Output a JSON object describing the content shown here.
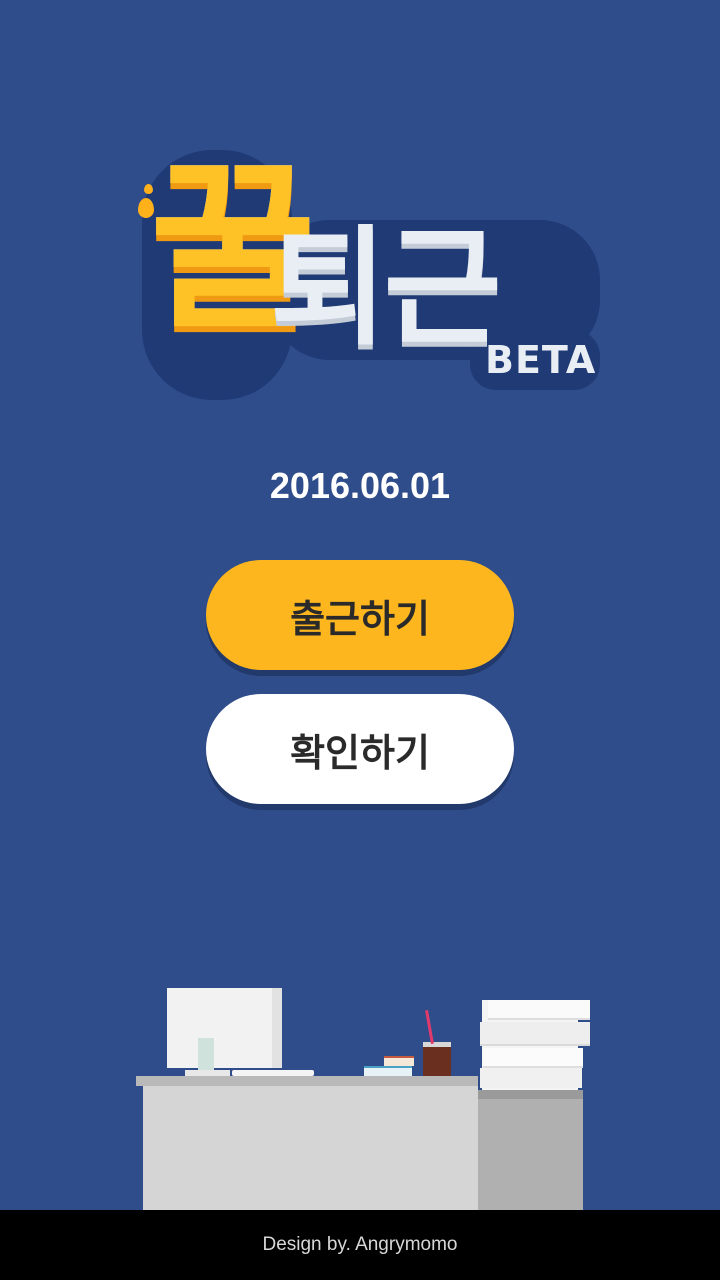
{
  "app": {
    "logo_main": "꿀",
    "logo_rest": "퇴근",
    "logo_badge": "BETA"
  },
  "date": "2016.06.01",
  "buttons": {
    "checkin_label": "출근하기",
    "confirm_label": "확인하기"
  },
  "footer": {
    "credit": "Design by. Angrymomo"
  },
  "colors": {
    "background": "#2f4c8b",
    "primary_button": "#fdb61d",
    "secondary_button": "#ffffff",
    "footer": "#000000"
  }
}
